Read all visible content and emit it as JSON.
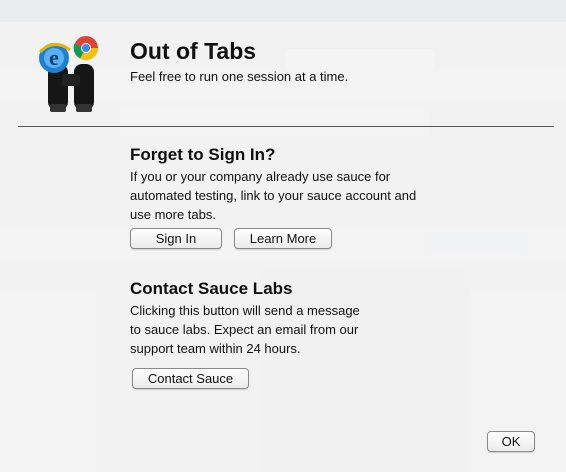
{
  "dialog": {
    "title": "Out of Tabs",
    "subtitle": "Feel free to run one session at a time."
  },
  "sign_in_section": {
    "heading": "Forget to Sign In?",
    "body": "If you or your company already use sauce for\nautomated testing, link to your sauce account and\nuse more tabs.",
    "sign_in_label": "Sign In",
    "learn_more_label": "Learn More"
  },
  "contact_section": {
    "heading": "Contact Sauce Labs",
    "body": "Clicking this button will send a message\nto sauce labs. Expect an email from our\nsupport team within 24 hours.",
    "contact_label": "Contact Sauce"
  },
  "footer": {
    "ok_label": "OK"
  },
  "icons": {
    "logo": "browser-binoculars-logo-icon"
  }
}
